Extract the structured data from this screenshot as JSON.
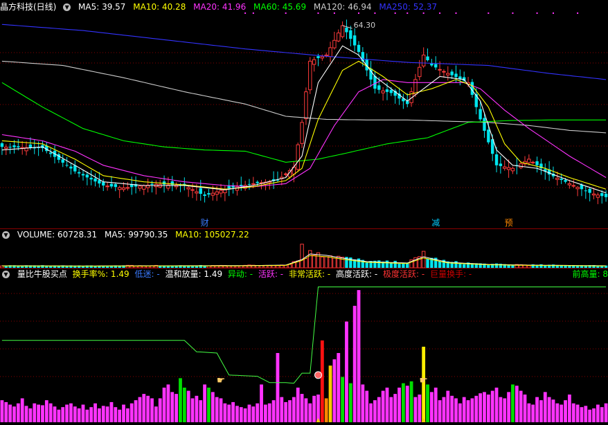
{
  "panel1": {
    "title": "晶方科技(日线)",
    "ma": [
      {
        "label": "MA5: 39.57",
        "color": "#ffffff"
      },
      {
        "label": "MA10: 40.28",
        "color": "#ffff00"
      },
      {
        "label": "MA20: 41.96",
        "color": "#ff33ff"
      },
      {
        "label": "MA60: 45.69",
        "color": "#00ff00"
      },
      {
        "label": "MA120: 46.94",
        "color": "#cccccc"
      },
      {
        "label": "MA250: 52.37",
        "color": "#3333ff"
      }
    ],
    "high_label": "64.30",
    "events": [
      {
        "label": "财",
        "index": 50,
        "color": "#3a7bff"
      },
      {
        "label": "减",
        "index": 107,
        "color": "#00ccff"
      },
      {
        "label": "预",
        "index": 125,
        "color": "#ff8800"
      }
    ]
  },
  "panel2": {
    "labels": [
      {
        "text": "VOLUME: 60728.31",
        "color": "#ffffff"
      },
      {
        "text": "MA5: 99790.35",
        "color": "#ffffff"
      },
      {
        "text": "MA10: 105027.22",
        "color": "#ffff00"
      }
    ]
  },
  "panel3": {
    "labels": [
      {
        "text": "量比牛股买点",
        "color": "#ffffff"
      },
      {
        "text": "换手率%: 1.49",
        "color": "#ffff00"
      },
      {
        "text": "低迷: -",
        "color": "#3a7bff"
      },
      {
        "text": "温和放量: 1.49",
        "color": "#ffffff"
      },
      {
        "text": "异动: -",
        "color": "#00ff00"
      },
      {
        "text": "活跃: -",
        "color": "#ff33ff"
      },
      {
        "text": "非常活跃: -",
        "color": "#ffff00"
      },
      {
        "text": "高度活跃: -",
        "color": "#ffffff"
      },
      {
        "text": "极度活跃: -",
        "color": "#ff3333"
      },
      {
        "text": "巨量换手: -",
        "color": "#cc0000"
      }
    ],
    "right_label": "前高量: 8"
  },
  "colors": {
    "up": "#ff3b3b",
    "down": "#00e5ee",
    "ma5": "#ffffff",
    "ma10": "#ffff00",
    "ma20": "#ff33ff",
    "ma60": "#00ff00",
    "ma120": "#cccccc",
    "ma250": "#3333ff",
    "grid": "#8b0000"
  },
  "chart_data": [
    {
      "type": "candlestick",
      "n": 150,
      "ylim": [
        33,
        66
      ],
      "grid": true,
      "price_anchors": [
        [
          0,
          44.5
        ],
        [
          10,
          44.3
        ],
        [
          18,
          40.5
        ],
        [
          25,
          38.2
        ],
        [
          30,
          37.8
        ],
        [
          38,
          38.4
        ],
        [
          45,
          38.2
        ],
        [
          50,
          36.5
        ],
        [
          55,
          37.6
        ],
        [
          62,
          38.5
        ],
        [
          68,
          39.0
        ],
        [
          72,
          41.2
        ],
        [
          74,
          48.5
        ],
        [
          76,
          58.5
        ],
        [
          80,
          59.5
        ],
        [
          84,
          64.3
        ],
        [
          88,
          60.0
        ],
        [
          92,
          54.0
        ],
        [
          96,
          53.3
        ],
        [
          100,
          51.5
        ],
        [
          104,
          59.5
        ],
        [
          106,
          57.8
        ],
        [
          110,
          56.5
        ],
        [
          115,
          55.0
        ],
        [
          118,
          49.0
        ],
        [
          122,
          41.5
        ],
        [
          126,
          41.0
        ],
        [
          130,
          42.5
        ],
        [
          135,
          40.0
        ],
        [
          140,
          38.5
        ],
        [
          145,
          37.0
        ],
        [
          149,
          36.3
        ]
      ],
      "ma5": [
        [
          0,
          44.0
        ],
        [
          10,
          44.5
        ],
        [
          18,
          41.5
        ],
        [
          25,
          38.8
        ],
        [
          35,
          38.2
        ],
        [
          45,
          38.2
        ],
        [
          55,
          37.5
        ],
        [
          62,
          38.2
        ],
        [
          70,
          39.5
        ],
        [
          74,
          43
        ],
        [
          78,
          55
        ],
        [
          84,
          61
        ],
        [
          88,
          59.5
        ],
        [
          92,
          56
        ],
        [
          100,
          52
        ],
        [
          104,
          54
        ],
        [
          108,
          56
        ],
        [
          114,
          55.5
        ],
        [
          118,
          52
        ],
        [
          122,
          44
        ],
        [
          126,
          41.5
        ],
        [
          132,
          41.0
        ],
        [
          140,
          39
        ],
        [
          149,
          37.0
        ]
      ],
      "ma10": [
        [
          0,
          45.5
        ],
        [
          10,
          45.0
        ],
        [
          18,
          42.5
        ],
        [
          25,
          39.8
        ],
        [
          35,
          38.8
        ],
        [
          45,
          38.3
        ],
        [
          55,
          37.6
        ],
        [
          62,
          38.0
        ],
        [
          70,
          39.0
        ],
        [
          74,
          41
        ],
        [
          78,
          49
        ],
        [
          84,
          57
        ],
        [
          88,
          58.5
        ],
        [
          94,
          56
        ],
        [
          100,
          53
        ],
        [
          106,
          54
        ],
        [
          112,
          55.5
        ],
        [
          116,
          54.5
        ],
        [
          120,
          51
        ],
        [
          124,
          45
        ],
        [
          128,
          42
        ],
        [
          134,
          41
        ],
        [
          140,
          39.5
        ],
        [
          149,
          37.6
        ]
      ],
      "ma20": [
        [
          0,
          46.5
        ],
        [
          10,
          45.5
        ],
        [
          18,
          43.8
        ],
        [
          25,
          41.5
        ],
        [
          35,
          39.8
        ],
        [
          45,
          38.8
        ],
        [
          55,
          38.2
        ],
        [
          62,
          38.0
        ],
        [
          70,
          38.5
        ],
        [
          76,
          41
        ],
        [
          82,
          48
        ],
        [
          88,
          53.5
        ],
        [
          94,
          55.5
        ],
        [
          100,
          55
        ],
        [
          108,
          55
        ],
        [
          114,
          55
        ],
        [
          118,
          54
        ],
        [
          124,
          50.5
        ],
        [
          130,
          47.5
        ],
        [
          140,
          43
        ],
        [
          149,
          39.5
        ]
      ],
      "ma60": [
        [
          0,
          55
        ],
        [
          10,
          51
        ],
        [
          20,
          47.5
        ],
        [
          30,
          45.5
        ],
        [
          40,
          44.5
        ],
        [
          50,
          44
        ],
        [
          60,
          43.8
        ],
        [
          70,
          42
        ],
        [
          78,
          42.5
        ],
        [
          85,
          43.5
        ],
        [
          95,
          45
        ],
        [
          105,
          46
        ],
        [
          115,
          48.5
        ],
        [
          125,
          48.8
        ],
        [
          135,
          48.9
        ],
        [
          149,
          48.9
        ]
      ],
      "ma120": [
        [
          0,
          58.5
        ],
        [
          15,
          57.8
        ],
        [
          30,
          55.8
        ],
        [
          45,
          53.5
        ],
        [
          60,
          51.5
        ],
        [
          70,
          49.5
        ],
        [
          80,
          49
        ],
        [
          90,
          48.9
        ],
        [
          100,
          48.9
        ],
        [
          110,
          48.7
        ],
        [
          120,
          48.5
        ],
        [
          130,
          48.0
        ],
        [
          140,
          47.2
        ],
        [
          149,
          46.8
        ]
      ],
      "ma250": [
        [
          0,
          64.5
        ],
        [
          20,
          63.5
        ],
        [
          40,
          62.0
        ],
        [
          60,
          60.5
        ],
        [
          80,
          59.3
        ],
        [
          100,
          58.3
        ],
        [
          120,
          57.8
        ],
        [
          135,
          56.5
        ],
        [
          149,
          55.5
        ]
      ]
    },
    {
      "type": "bar",
      "title": "VOLUME",
      "anchors": [
        [
          0,
          30
        ],
        [
          20,
          28
        ],
        [
          40,
          30
        ],
        [
          60,
          32
        ],
        [
          70,
          40
        ],
        [
          74,
          120
        ],
        [
          76,
          200
        ],
        [
          80,
          180
        ],
        [
          84,
          140
        ],
        [
          90,
          90
        ],
        [
          100,
          70
        ],
        [
          104,
          160
        ],
        [
          110,
          80
        ],
        [
          120,
          50
        ],
        [
          130,
          40
        ],
        [
          140,
          35
        ],
        [
          149,
          30
        ]
      ],
      "spikes": [
        [
          74,
          330
        ],
        [
          78,
          230
        ],
        [
          104,
          220
        ]
      ],
      "ylim": [
        0,
        340
      ]
    },
    {
      "type": "bar",
      "title": "量比牛股买点",
      "values": [
        35,
        32,
        28,
        25,
        30,
        38,
        26,
        22,
        30,
        28,
        27,
        35,
        30,
        25,
        20,
        24,
        28,
        30,
        25,
        22,
        28,
        20,
        24,
        30,
        22,
        26,
        25,
        32,
        24,
        20,
        28,
        22,
        30,
        35,
        40,
        45,
        42,
        38,
        25,
        38,
        55,
        60,
        48,
        45,
        70,
        55,
        50,
        38,
        42,
        35,
        60,
        55,
        48,
        40,
        38,
        30,
        28,
        32,
        26,
        24,
        22,
        28,
        25,
        30,
        60,
        28,
        30,
        35,
        110,
        40,
        32,
        35,
        40,
        55,
        45,
        38,
        30,
        42,
        44,
        130,
        38,
        90,
        100,
        110,
        72,
        160,
        62,
        185,
        210,
        60,
        50,
        30,
        35,
        40,
        50,
        55,
        40,
        45,
        55,
        62,
        58,
        65,
        40,
        44,
        120,
        60,
        48,
        55,
        35,
        40,
        50,
        42,
        38,
        30,
        40,
        35,
        38,
        42,
        46,
        48,
        44,
        50,
        55,
        40,
        38,
        48,
        60,
        58,
        50,
        44,
        30,
        28,
        40,
        35,
        48,
        40,
        36,
        30,
        28,
        35,
        44,
        30,
        28,
        24,
        26,
        20,
        22,
        28,
        24,
        30
      ],
      "line": [
        [
          0,
          130
        ],
        [
          45,
          130
        ],
        [
          48,
          112
        ],
        [
          53,
          110
        ],
        [
          56,
          75
        ],
        [
          63,
          73
        ],
        [
          66,
          63
        ],
        [
          70,
          63
        ],
        [
          72,
          62
        ],
        [
          74,
          78
        ],
        [
          76,
          78
        ],
        [
          78,
          215
        ],
        [
          86,
          215
        ],
        [
          149,
          215
        ]
      ],
      "ylim": [
        0,
        220
      ]
    }
  ]
}
